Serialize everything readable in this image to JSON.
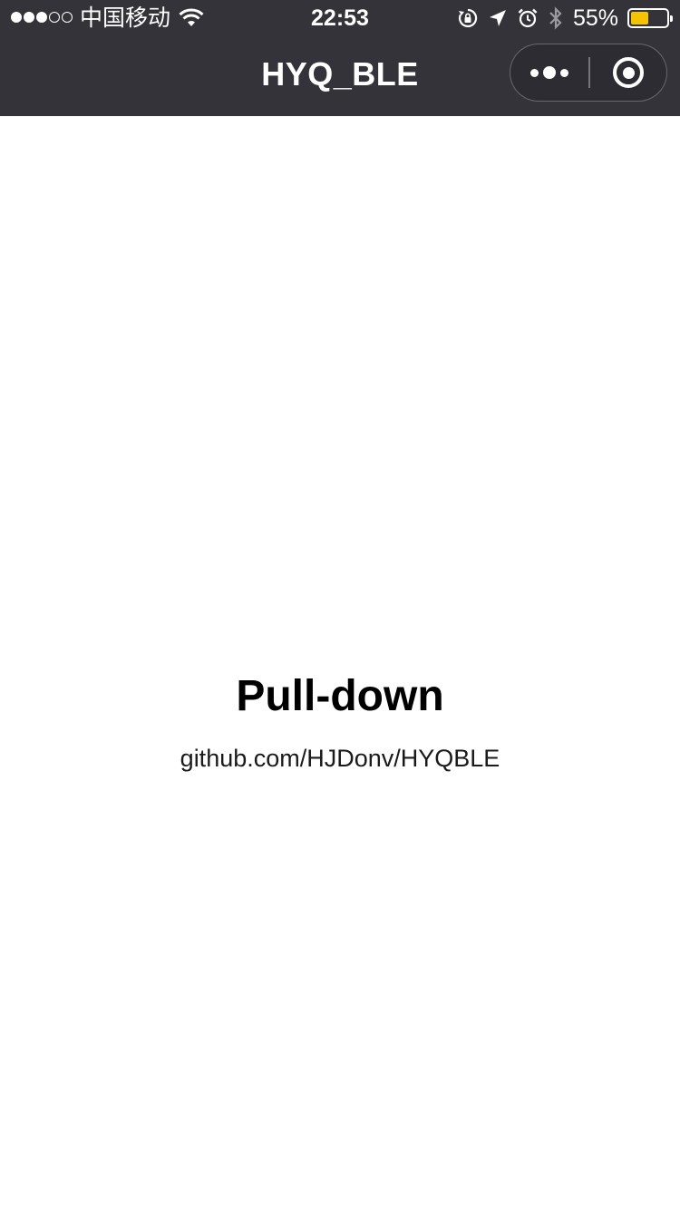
{
  "status_bar": {
    "carrier": "中国移动",
    "time": "22:53",
    "battery_percent": "55%",
    "battery_level": 0.55,
    "signal_bars_filled": 3,
    "signal_bars_total": 5,
    "icons": [
      "wifi-icon",
      "rotation-lock-icon",
      "location-icon",
      "alarm-icon",
      "bluetooth-icon",
      "battery-icon"
    ]
  },
  "nav_bar": {
    "title": "HYQ_BLE",
    "background": "#343339",
    "more_icon": "more-dots-icon",
    "close_icon": "target-close-icon"
  },
  "content": {
    "title": "Pull-down",
    "link": "github.com/HJDonv/HYQBLE"
  },
  "colors": {
    "battery_fill": "#f5c400",
    "page_background": "#ffffff"
  }
}
